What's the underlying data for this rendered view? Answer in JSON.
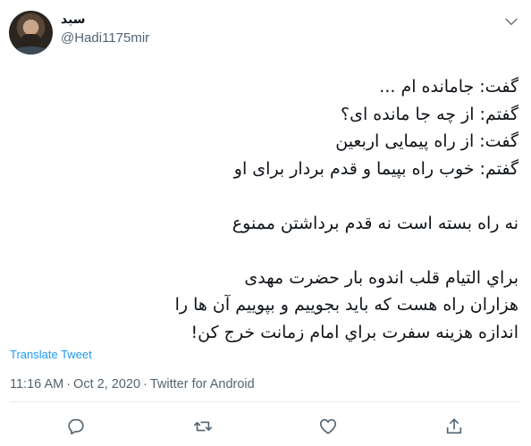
{
  "author": {
    "display_name": "سید",
    "handle": "@Hadi1175mir",
    "avatar_icon": "user-avatar-photo"
  },
  "tweet": {
    "lines": [
      "گفت: جامانده ام ...",
      "گفتم: از چه جا مانده ای؟",
      "گفت: از راه پیمایی اربعین",
      "گفتم: خوب راه بپیما و قدم بردار برای او",
      "",
      "نه راه بسته است نه قدم برداشتن ممنوع",
      "",
      "براي التيام قلب اندوه بار حضرت مهدی",
      "هزاران راه هست که باید بجوییم و بپوییم آن ها را",
      "اندازه هزینه سفرت براي امام زمانت خرج کن!"
    ],
    "translate_label": "Translate Tweet",
    "time": "11:16 AM",
    "separator": "·",
    "date": "Oct 2, 2020",
    "source": "Twitter for Android"
  },
  "actions": {
    "reply_icon": "reply-icon",
    "retweet_icon": "retweet-icon",
    "like_icon": "like-icon",
    "share_icon": "share-icon"
  },
  "colors": {
    "text": "#0f1419",
    "secondary": "#536471",
    "link": "#1d9bf0",
    "divider": "#e6ecf0"
  }
}
